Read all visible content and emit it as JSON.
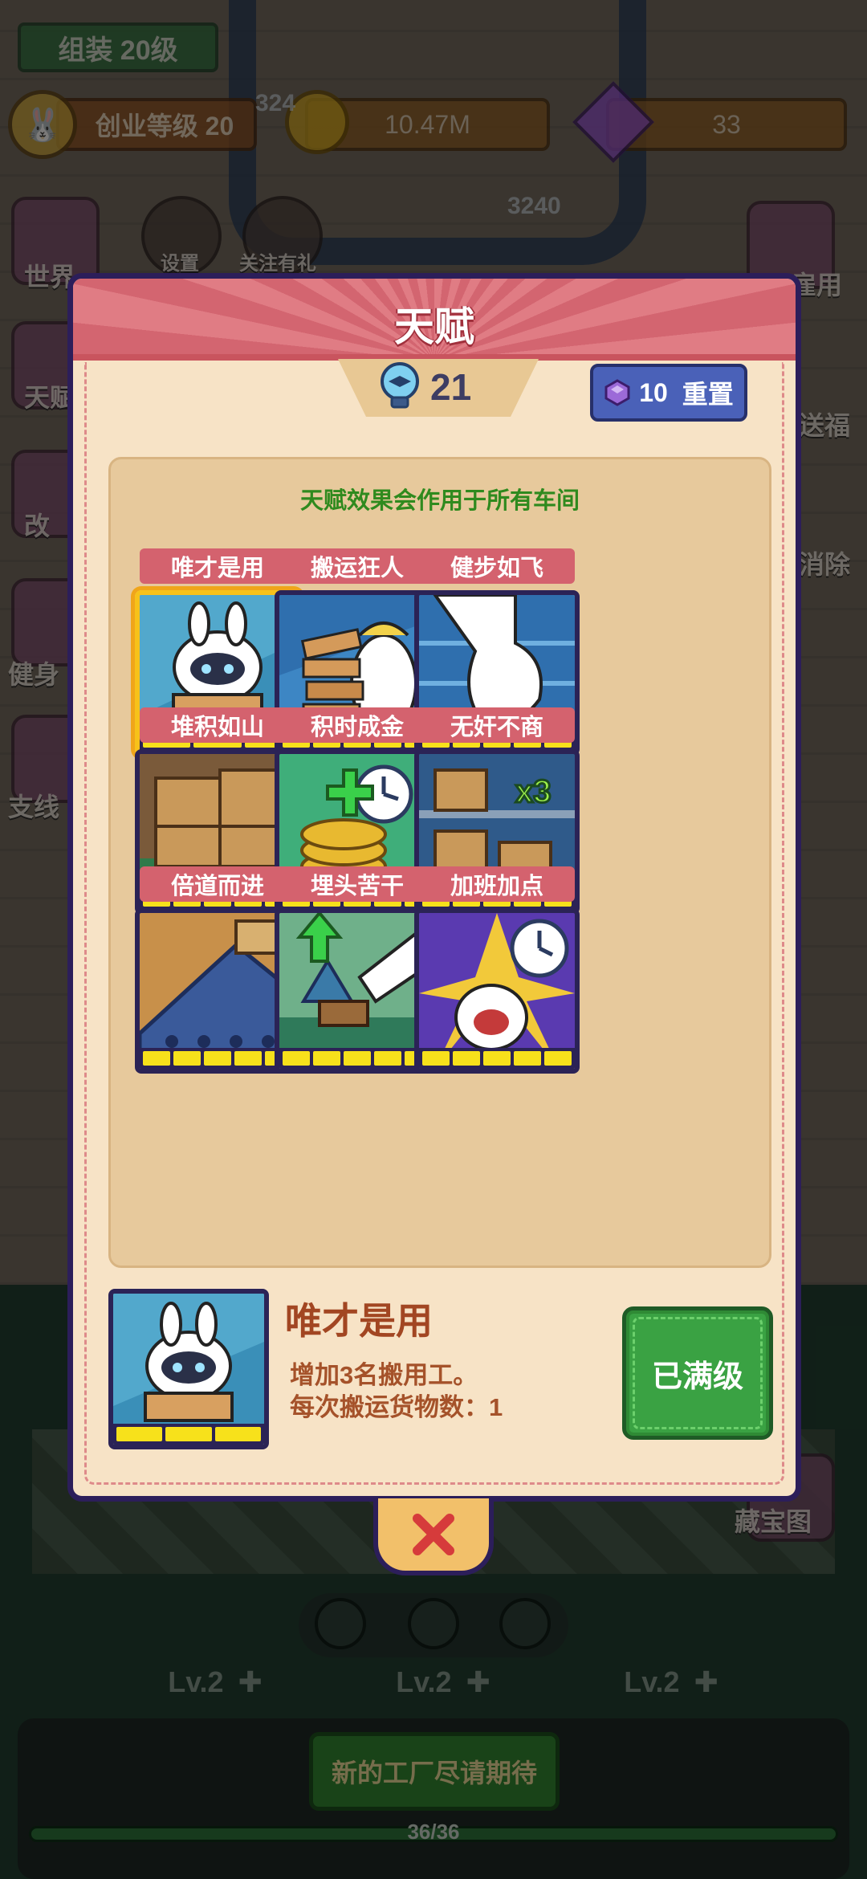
{
  "hud": {
    "assembly_level": "组装  20级",
    "business_level": "创业等级 20",
    "coins": "10.47M",
    "gems": "33",
    "bg_number_1": "324",
    "bg_number_2": "3240"
  },
  "side_menu": {
    "world": "世界",
    "settings": "设置",
    "follow_gift": "关注有礼",
    "talent": "天赋",
    "renovate": "改",
    "fitness": "健身",
    "branch": "支线",
    "hire": "雇用",
    "welfare": "送福",
    "eliminate": "消除",
    "treasure_map": "藏宝图"
  },
  "bottom": {
    "lv_labels": [
      "Lv.2",
      "Lv.2",
      "Lv.2"
    ],
    "new_factory": "新的工厂尽请期待",
    "progress_text": "36/36",
    "progress": 1.0
  },
  "dialog": {
    "title": "天赋",
    "talent_points": "21",
    "reset_cost": "10",
    "reset_label": "重置",
    "note": "天赋效果会作用于所有车间",
    "talents": [
      {
        "name": "唯才是用",
        "pips_filled": 3,
        "pips_total": 3,
        "selected": true,
        "icon": "bunny-robot-icon"
      },
      {
        "name": "搬运狂人",
        "pips_filled": 5,
        "pips_total": 5,
        "icon": "carry-boxes-icon"
      },
      {
        "name": "健步如飞",
        "pips_filled": 5,
        "pips_total": 5,
        "icon": "running-foot-icon"
      },
      {
        "name": "堆积如山",
        "pips_filled": 5,
        "pips_total": 5,
        "icon": "box-pile-icon"
      },
      {
        "name": "积时成金",
        "pips_filled": 5,
        "pips_total": 5,
        "icon": "coins-clock-icon"
      },
      {
        "name": "无奸不商",
        "pips_filled": 5,
        "pips_total": 5,
        "icon": "shelf-x3-icon",
        "badge": "x3"
      },
      {
        "name": "倍道而进",
        "pips_filled": 5,
        "pips_total": 5,
        "icon": "conveyor-icon"
      },
      {
        "name": "埋头苦干",
        "pips_filled": 5,
        "pips_total": 5,
        "icon": "hammer-upgrade-icon"
      },
      {
        "name": "加班加点",
        "pips_filled": 5,
        "pips_total": 5,
        "icon": "overtime-clock-icon"
      }
    ],
    "detail": {
      "name": "唯才是用",
      "desc_line1": "增加3名搬用工。",
      "desc_line2": "每次搬运货物数：1",
      "button": "已满级",
      "pips_filled": 3
    },
    "colors": {
      "header": "#d36570",
      "name_tag": "#d4626e",
      "selected_border": "#f7c21a",
      "maxed_button": "#3aa243"
    }
  }
}
